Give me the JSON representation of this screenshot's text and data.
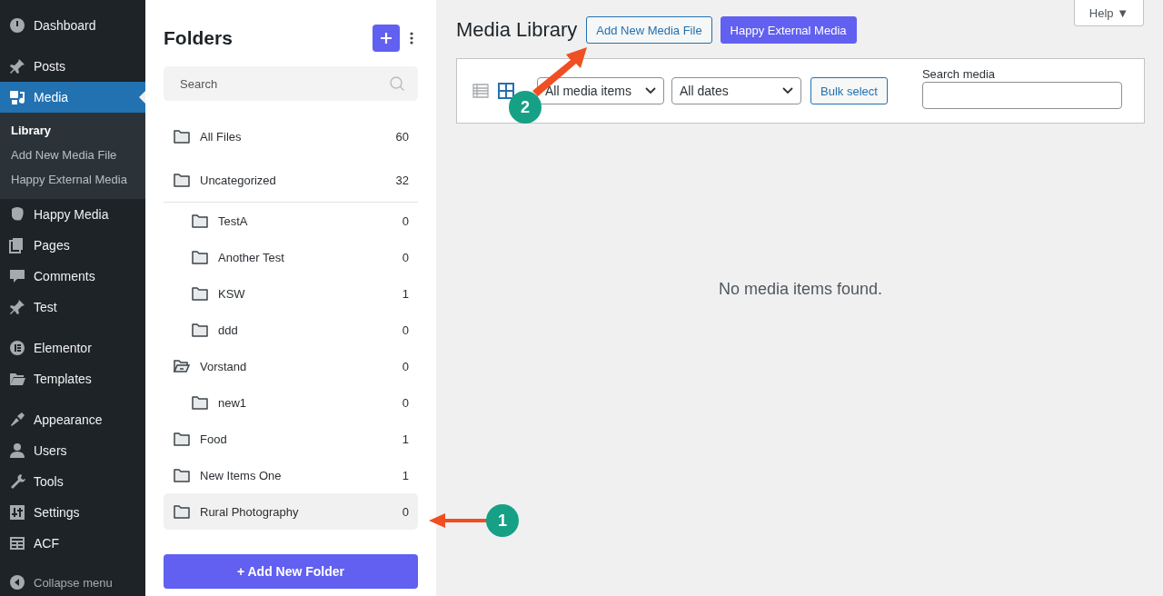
{
  "admin_menu": {
    "groups": [
      [
        {
          "label": "Dashboard",
          "selected": false
        }
      ],
      [
        {
          "label": "Posts",
          "selected": false
        },
        {
          "label": "Media",
          "selected": true,
          "submenu": [
            {
              "label": "Library",
              "selected": true
            },
            {
              "label": "Add New Media File",
              "selected": false
            },
            {
              "label": "Happy External Media",
              "selected": false
            }
          ]
        },
        {
          "label": "Happy Media",
          "selected": false
        },
        {
          "label": "Pages",
          "selected": false
        },
        {
          "label": "Comments",
          "selected": false
        },
        {
          "label": "Test",
          "selected": false
        }
      ],
      [
        {
          "label": "Elementor",
          "selected": false
        },
        {
          "label": "Templates",
          "selected": false
        }
      ],
      [
        {
          "label": "Appearance",
          "selected": false
        },
        {
          "label": "Users",
          "selected": false
        },
        {
          "label": "Tools",
          "selected": false
        },
        {
          "label": "Settings",
          "selected": false
        },
        {
          "label": "ACF",
          "selected": false
        }
      ]
    ],
    "collapse": "Collapse menu"
  },
  "folders_panel": {
    "title": "Folders",
    "search": {
      "placeholder": "Search"
    },
    "pinned": [
      {
        "name": "All Files",
        "count": "60",
        "selected": false
      },
      {
        "name": "Uncategorized",
        "count": "32",
        "selected": false
      }
    ],
    "tree": [
      {
        "name": "TestA",
        "count": "0",
        "selected": false,
        "nested": true
      },
      {
        "name": "Another Test",
        "count": "0",
        "selected": false,
        "nested": true
      },
      {
        "name": "KSW",
        "count": "1",
        "selected": false,
        "nested": true
      },
      {
        "name": "ddd",
        "count": "0",
        "selected": false,
        "nested": true
      },
      {
        "name": "Vorstand",
        "count": "0",
        "selected": false,
        "expanded": true,
        "children": [
          {
            "name": "new1",
            "count": "0",
            "selected": false
          }
        ]
      },
      {
        "name": "Food",
        "count": "1",
        "selected": false
      },
      {
        "name": "New Items One",
        "count": "1",
        "selected": false
      },
      {
        "name": "Rural Photography",
        "count": "0",
        "selected": true
      }
    ],
    "add_button": "+ Add New Folder"
  },
  "main": {
    "title": "Media Library",
    "buttons": [
      {
        "label": "Add New Media File",
        "kind": "outline"
      },
      {
        "label": "Happy External Media",
        "kind": "primary"
      }
    ],
    "help": "Help ▼",
    "toolbar": {
      "view_modes": [
        {
          "kind": "list",
          "selected": false
        },
        {
          "kind": "grid",
          "selected": true
        }
      ],
      "filters": [
        {
          "value": "All media items"
        },
        {
          "value": "All dates"
        }
      ],
      "bulk_select": "Bulk select",
      "search_label": "Search media"
    },
    "empty_message": "No media items found."
  },
  "annotations": [
    {
      "label": "1",
      "kind": "folder"
    },
    {
      "label": "2",
      "kind": "button"
    }
  ]
}
